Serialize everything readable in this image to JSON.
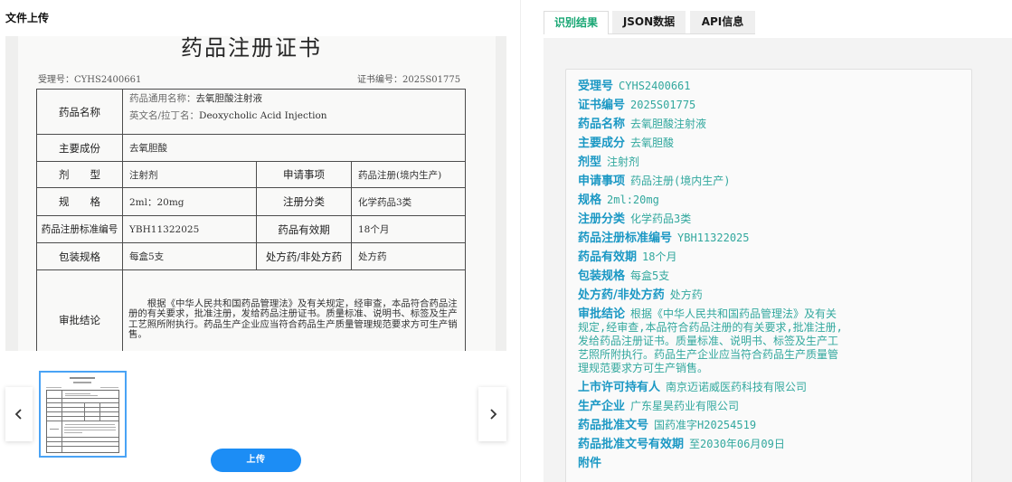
{
  "upload_panel": {
    "title": "文件上传",
    "upload_button_label": "上传"
  },
  "icons": {
    "prev": "chevron-left-icon",
    "next": "chevron-right-icon"
  },
  "certificate": {
    "heading": "药品注册证书",
    "acceptance_no": "受理号：CYHS2400661",
    "certificate_no": "证书编号：2025S01775",
    "drug_name_label": "药品名称",
    "generic_name_caption": "药品通用名称：",
    "generic_name": "去氧胆酸注射液",
    "english_name_caption": "英文名/拉丁名：",
    "english_name": "Deoxycholic Acid Injection",
    "ingredient_label": "主要成份",
    "ingredient": "去氧胆酸",
    "dosage_form_label": "剂型",
    "dosage_form": "注射剂",
    "application_label": "申请事项",
    "application": "药品注册(境内生产)",
    "spec_label": "规格",
    "spec": "2ml：20mg",
    "category_label": "注册分类",
    "category": "化学药品3类",
    "standard_label": "药品注册标准编号",
    "standard": "YBH11322025",
    "validity_label": "药品有效期",
    "validity": "18个月",
    "package_label": "包装规格",
    "package": "每盒5支",
    "rx_label": "处方药/非处方药",
    "rx": "处方药",
    "conclusion_label": "审批结论",
    "conclusion": "根据《中华人民共和国药品管理法》及有关规定，经审查，本品符合药品注册的有关要求，批准注册，发给药品注册证书。质量标准、说明书、标签及生产工艺照所附执行。药品生产企业应当符合药品生产质量管理规范要求方可生产销售。"
  },
  "tabs": [
    {
      "label": "识别结果",
      "active": true
    },
    {
      "label": "JSON数据",
      "active": false
    },
    {
      "label": "API信息",
      "active": false
    }
  ],
  "result": {
    "items": [
      {
        "label": "受理号",
        "value": "CYHS2400661"
      },
      {
        "label": "证书编号",
        "value": "2025S01775"
      },
      {
        "label": "药品名称",
        "value": "去氧胆酸注射液"
      },
      {
        "label": "主要成分",
        "value": "去氧胆酸"
      },
      {
        "label": "剂型",
        "value": "注射剂"
      },
      {
        "label": "申请事项",
        "value": "药品注册(境内生产)"
      },
      {
        "label": "规格",
        "value": "2ml:20mg"
      },
      {
        "label": "注册分类",
        "value": "化学药品3类"
      },
      {
        "label": "药品注册标准编号",
        "value": "YBH11322025"
      },
      {
        "label": "药品有效期",
        "value": "18个月"
      },
      {
        "label": "包装规格",
        "value": "每盒5支"
      },
      {
        "label": "处方药/非处方药",
        "value": "处方药"
      },
      {
        "label": "审批结论",
        "value": "根据《中华人民共和国药品管理法》及有关规定,经审查,本品符合药品注册的有关要求,批准注册,发给药品注册证书。质量标准、说明书、标签及生产工艺照所附执行。药品生产企业应当符合药品生产质量管理规范要求方可生产销售。"
      },
      {
        "label": "上市许可持有人",
        "value": "南京迈诺威医药科技有限公司"
      },
      {
        "label": "生产企业",
        "value": "广东星昊药业有限公司"
      },
      {
        "label": "药品批准文号",
        "value": "国药准字H20254519"
      },
      {
        "label": "药品批准文号有效期",
        "value": "至2030年06月09日"
      },
      {
        "label": "附件"
      }
    ]
  },
  "colors": {
    "tab_active": "#17a673",
    "result_label": "#1b98c4",
    "result_value": "#32a89e",
    "upload_button": "#1c8df5",
    "thumbnail_border": "#4aa3f5"
  }
}
